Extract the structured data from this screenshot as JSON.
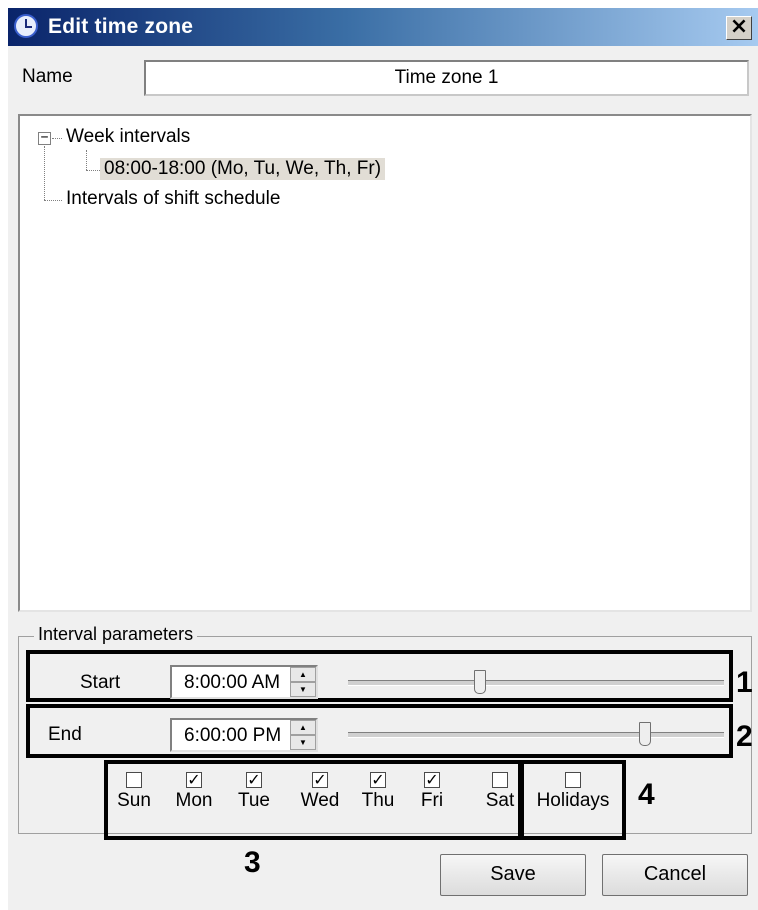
{
  "window": {
    "title": "Edit time zone",
    "close_label": "×"
  },
  "name": {
    "label": "Name",
    "value": "Time zone 1"
  },
  "tree": {
    "toggle": "−",
    "week_intervals": "Week intervals",
    "interval_item": "08:00-18:00 (Mo, Tu, We, Th, Fr)",
    "shift_schedule": "Intervals of shift schedule"
  },
  "interval_parameters": {
    "title": "Interval parameters",
    "start": {
      "label": "Start",
      "value": "8:00:00 AM",
      "slider_fraction": 0.35
    },
    "end": {
      "label": "End",
      "value": "6:00:00 PM",
      "slider_fraction": 0.79
    }
  },
  "days": [
    {
      "label": "Sun",
      "checked": false
    },
    {
      "label": "Mon",
      "checked": true
    },
    {
      "label": "Tue",
      "checked": true
    },
    {
      "label": "Wed",
      "checked": true
    },
    {
      "label": "Thu",
      "checked": true
    },
    {
      "label": "Fri",
      "checked": true
    },
    {
      "label": "Sat",
      "checked": false
    }
  ],
  "holidays": {
    "label": "Holidays",
    "checked": false
  },
  "callouts": {
    "c1": "1",
    "c2": "2",
    "c3": "3",
    "c4": "4"
  },
  "buttons": {
    "save": "Save",
    "cancel": "Cancel"
  },
  "colors": {
    "title_bar_start": "#0a246a",
    "title_bar_end": "#a6caf0",
    "selection": "#e1ddd5"
  }
}
